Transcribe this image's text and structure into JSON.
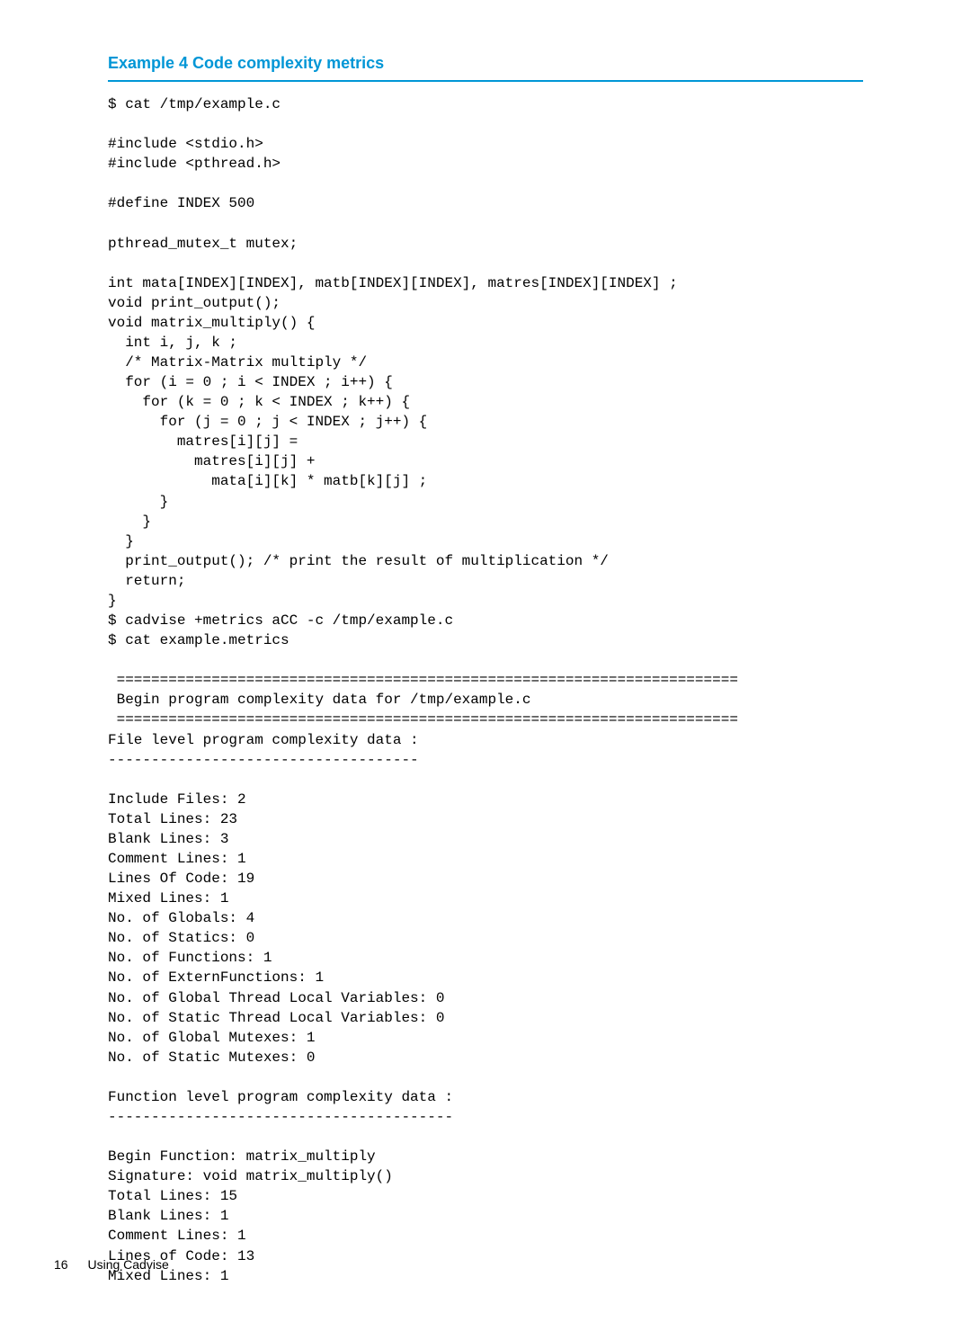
{
  "title": "Example 4 Code complexity metrics",
  "code": "$ cat /tmp/example.c\n\n#include <stdio.h>\n#include <pthread.h>\n\n#define INDEX 500\n\npthread_mutex_t mutex;\n\nint mata[INDEX][INDEX], matb[INDEX][INDEX], matres[INDEX][INDEX] ;\nvoid print_output();\nvoid matrix_multiply() {\n  int i, j, k ;\n  /* Matrix-Matrix multiply */\n  for (i = 0 ; i < INDEX ; i++) {\n    for (k = 0 ; k < INDEX ; k++) {\n      for (j = 0 ; j < INDEX ; j++) {\n        matres[i][j] =\n          matres[i][j] +\n            mata[i][k] * matb[k][j] ;\n      }\n    }\n  }\n  print_output(); /* print the result of multiplication */\n  return;\n}\n$ cadvise +metrics aCC -c /tmp/example.c\n$ cat example.metrics\n\n ========================================================================\n Begin program complexity data for /tmp/example.c\n ========================================================================\nFile level program complexity data :\n------------------------------------\n\nInclude Files: 2\nTotal Lines: 23\nBlank Lines: 3\nComment Lines: 1\nLines Of Code: 19\nMixed Lines: 1\nNo. of Globals: 4\nNo. of Statics: 0\nNo. of Functions: 1\nNo. of ExternFunctions: 1\nNo. of Global Thread Local Variables: 0\nNo. of Static Thread Local Variables: 0\nNo. of Global Mutexes: 1\nNo. of Static Mutexes: 0\n\nFunction level program complexity data :\n----------------------------------------\n\nBegin Function: matrix_multiply\nSignature: void matrix_multiply()\nTotal Lines: 15\nBlank Lines: 1\nComment Lines: 1\nLines of Code: 13\nMixed Lines: 1",
  "footer": {
    "page_number": "16",
    "section": "Using Cadvise"
  }
}
